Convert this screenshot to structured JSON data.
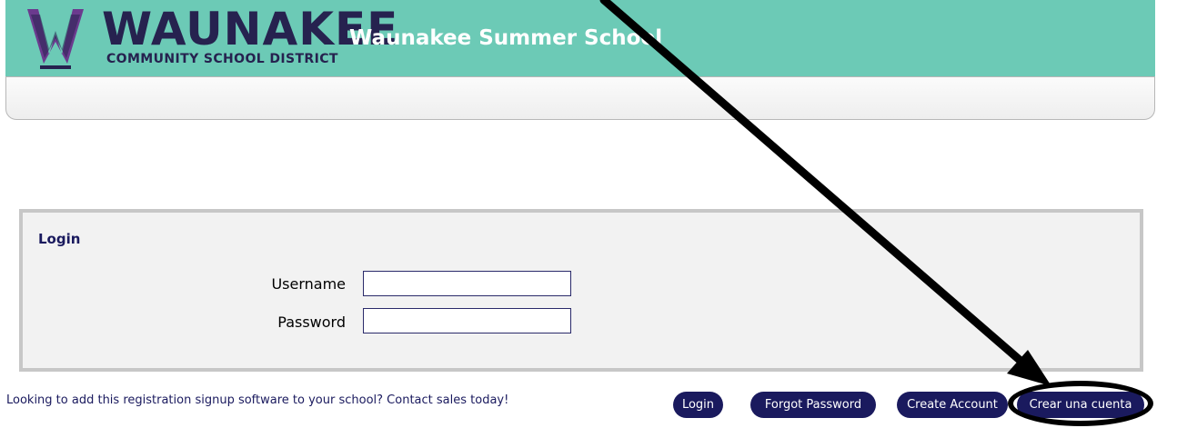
{
  "header": {
    "logo_word": "WAUNAKEE",
    "logo_subtitle": "COMMUNITY SCHOOL DISTRICT",
    "site_title": "Waunakee Summer School",
    "logo_icon": "w-logo-icon",
    "colors": {
      "banner": "#6ccab6",
      "logo_purple": "#6b3a8e",
      "logo_navy": "#26224f"
    }
  },
  "login": {
    "title": "Login",
    "username_label": "Username",
    "password_label": "Password",
    "username_value": "",
    "password_value": ""
  },
  "footer": {
    "note": "Looking to add this registration signup software to your school? Contact sales today!"
  },
  "buttons": {
    "login": "Login",
    "forgot_password": "Forgot Password",
    "create_account": "Create Account",
    "crear_cuenta": "Crear una cuenta",
    "color": "#1a1a5e"
  },
  "annotation": {
    "arrow_icon": "pointer-arrow-icon",
    "circle_icon": "highlight-circle-icon"
  }
}
